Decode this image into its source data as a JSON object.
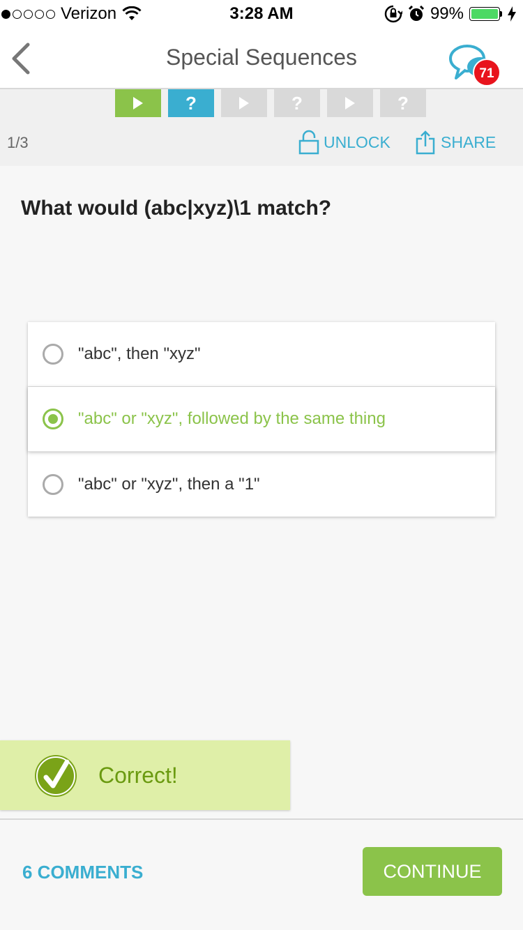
{
  "status_bar": {
    "carrier": "Verizon",
    "time": "3:28 AM",
    "battery": "99%",
    "battery_level": 0.99,
    "signal_bars_filled": 1,
    "signal_bars_total": 5
  },
  "header": {
    "title": "Special Sequences",
    "notification_count": "71"
  },
  "progress": {
    "steps": [
      {
        "type": "lesson",
        "state": "done"
      },
      {
        "type": "quiz",
        "state": "current",
        "label": "?"
      },
      {
        "type": "lesson",
        "state": "todo"
      },
      {
        "type": "quiz",
        "state": "todo",
        "label": "?"
      },
      {
        "type": "lesson",
        "state": "todo"
      },
      {
        "type": "quiz",
        "state": "todo",
        "label": "?"
      }
    ],
    "counter": "1/3"
  },
  "toolbar": {
    "unlock_label": "UNLOCK",
    "share_label": "SHARE"
  },
  "question": {
    "text": "What would (abc|xyz)\\1 match?",
    "options": [
      {
        "label": "\"abc\", then \"xyz\"",
        "selected": false
      },
      {
        "label": "\"abc\" or \"xyz\", followed by the same thing",
        "selected": true
      },
      {
        "label": "\"abc\" or \"xyz\", then a \"1\"",
        "selected": false
      }
    ]
  },
  "feedback": {
    "text": "Correct!"
  },
  "footer": {
    "comments_label": "6 COMMENTS",
    "continue_label": "CONTINUE"
  },
  "colors": {
    "accent_green": "#8bc34a",
    "accent_blue": "#3aaed0",
    "badge_red": "#e8141d"
  },
  "icons": [
    "back-chevron-icon",
    "chat-bubbles-icon",
    "play-icon",
    "question-icon",
    "lock-icon",
    "share-icon",
    "checkmark-icon",
    "wifi-icon",
    "alarm-icon",
    "rotation-lock-icon",
    "charging-icon"
  ]
}
